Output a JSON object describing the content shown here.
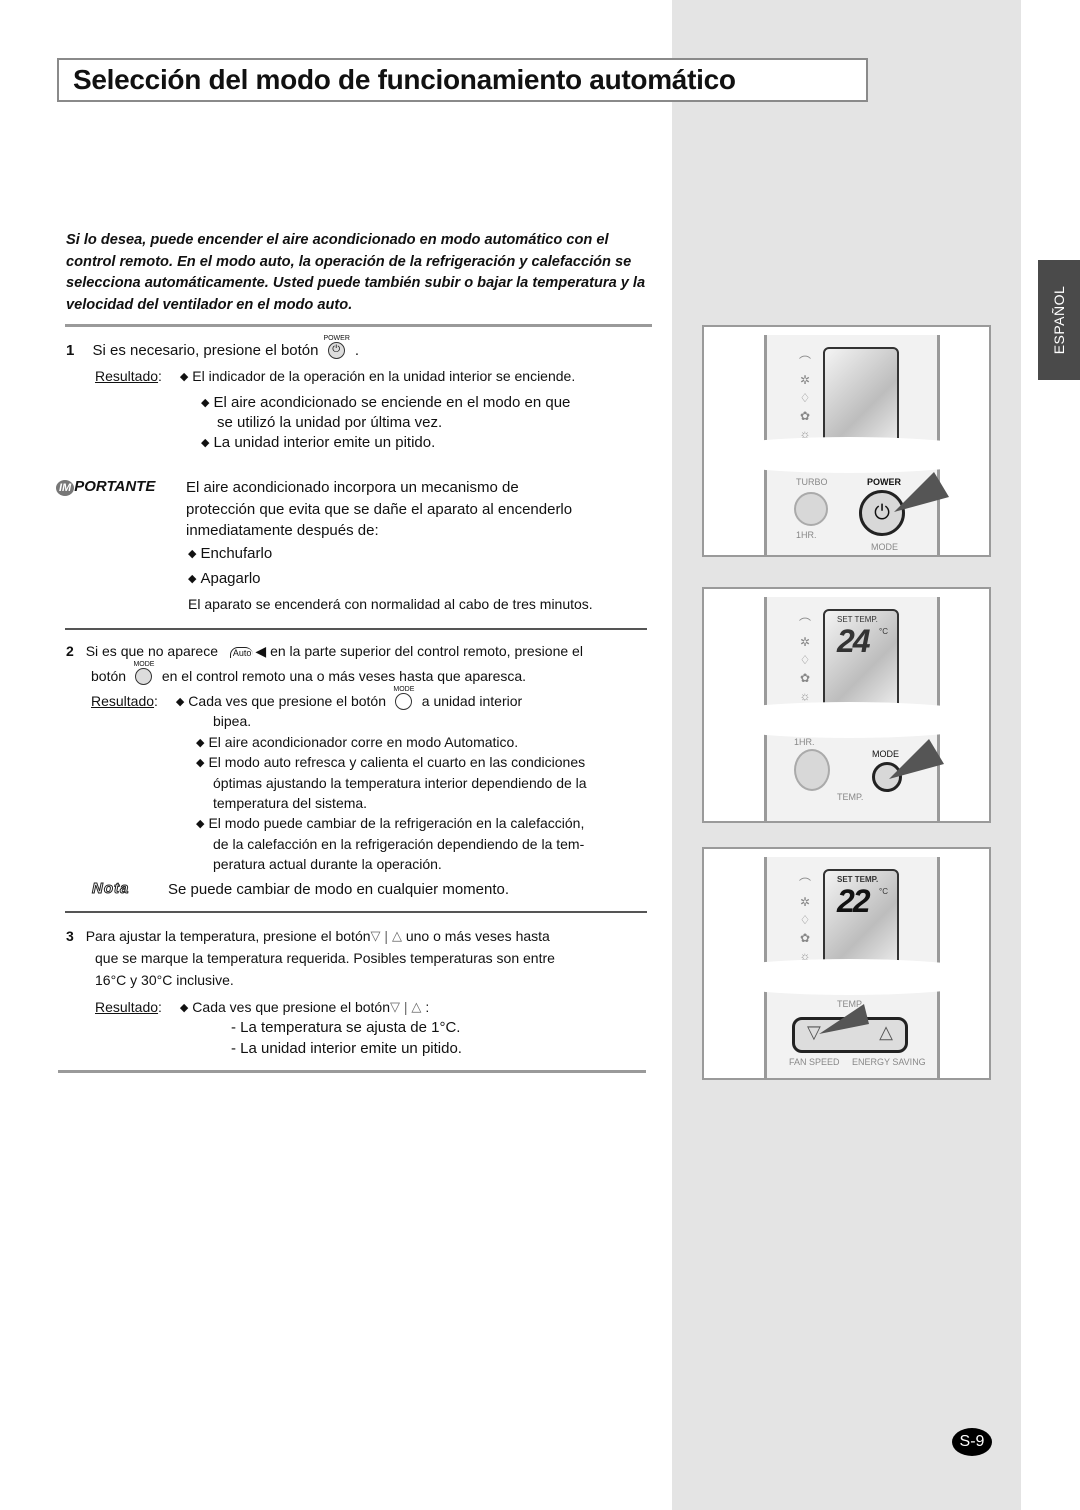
{
  "title": "Selección del modo de funcionamiento automático",
  "intro": "Si lo desea, puede encender el aire acondicionado en modo automático con el control remoto. En el modo auto, la operación de la refrigeración y calefacción se selecciona automáticamente. Usted puede también subir o bajar la temperatura y la velocidad del ventilador en el modo auto.",
  "step1": {
    "number": "1",
    "text_before": "Si es necesario, presione el botón",
    "text_after": ".",
    "button_caption": "POWER",
    "result_label": "Resultado",
    "results": [
      "El indicador de la operación en la unidad interior se enciende.",
      "El aire acondicionado se enciende en el modo en que",
      "se utilizó la unidad por última vez.",
      "La unidad interior emite un pitido."
    ]
  },
  "important": {
    "tag_im": "IM",
    "tag_rest": "PORTANTE",
    "lines": [
      "El aire acondicionado incorpora un mecanismo de",
      "protección que evita que se dañe el aparato al encenderlo",
      "inmediatamente después de:"
    ],
    "bullets": [
      "Enchufarlo",
      "Apagarlo"
    ],
    "footer": "El aparato se encenderá con normalidad al cabo de tres minutos."
  },
  "step2": {
    "number": "2",
    "line1_before": "Si es que no aparece",
    "auto_icon_label": "Auto",
    "line1_after": "en la parte superior del control remoto, presione el",
    "line2_before": "botón",
    "line2_after": "en el control remoto una o más veses hasta que aparesca.",
    "button_caption": "MODE",
    "result_label": "Resultado",
    "result1_before": "Cada ves que presione el botón",
    "result1_after": "a unidad interior",
    "result1_cont": "bipea.",
    "result2": "El aire acondicionador corre en modo Automatico.",
    "result3": [
      "El modo auto refresca y calienta el cuarto en las condiciones",
      "óptimas ajustando la temperatura interior dependiendo de la",
      "temperatura del sistema."
    ],
    "result4": [
      "El modo puede cambiar de la refrigeración en la calefacción,",
      "de la calefacción en la refrigeración dependiendo de la tem-",
      "peratura actual durante la operación."
    ]
  },
  "note": {
    "tag": "Nota",
    "text": "Se puede cambiar de modo en cualquier momento."
  },
  "step3": {
    "number": "3",
    "line1_before": "Para ajustar la temperatura, presione el botón",
    "line1_after": "uno o más veses hasta",
    "line2": "que se marque la temperatura requerida. Posibles temperaturas son entre",
    "line3": "16°C y 30°C inclusive.",
    "result_label": "Resultado",
    "result_before": "Cada ves que presione el botón",
    "result_after": ":",
    "sub1": "- La temperatura se ajusta de 1°C.",
    "sub2": "- La unidad interior emite un pitido."
  },
  "sidebar": {
    "language_tab": "ESPAÑOL",
    "page_number": "S-9"
  },
  "figures": {
    "fig1": {
      "labels": [
        "TURBO",
        "POWER",
        "1HR.",
        "MODE"
      ]
    },
    "fig2": {
      "set_temp": "SET TEMP.",
      "temp": "24",
      "unit": "°C",
      "labels": [
        "1HR.",
        "MODE",
        "TEMP."
      ]
    },
    "fig3": {
      "set_temp": "SET TEMP.",
      "temp": "22",
      "unit": "°C",
      "labels": [
        "TEMP.",
        "FAN SPEED",
        "ENERGY SAVING"
      ]
    }
  },
  "colors": {
    "sidebar_bg": "#e4e4e4",
    "language_tab_bg": "#4a4a4a",
    "title_border": "#8a8a8a"
  }
}
